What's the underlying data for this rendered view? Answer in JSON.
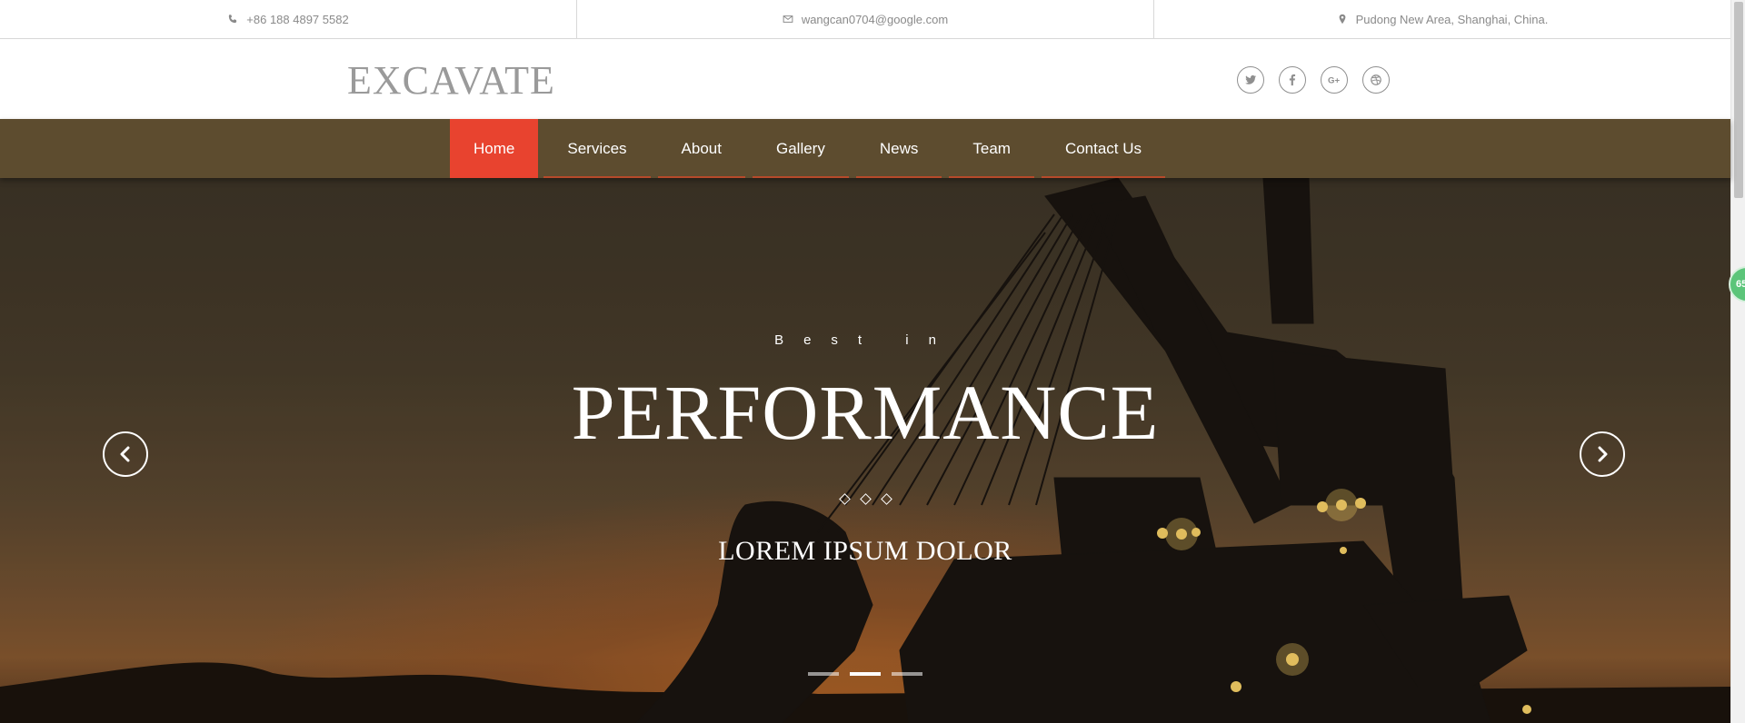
{
  "topbar": {
    "phone": "+86 188 4897 5582",
    "phone_icon": "phone-icon",
    "email": "wangcan0704@google.com",
    "email_icon": "envelope-icon",
    "address": "Pudong New Area, Shanghai, China.",
    "address_icon": "map-marker-icon"
  },
  "header": {
    "logo": "EXCAVATE",
    "social": [
      "twitter-icon",
      "facebook-icon",
      "google-plus-icon",
      "dribbble-icon"
    ]
  },
  "nav": {
    "items": [
      {
        "label": "Home",
        "active": true
      },
      {
        "label": "Services"
      },
      {
        "label": "About"
      },
      {
        "label": "Gallery"
      },
      {
        "label": "News"
      },
      {
        "label": "Team"
      },
      {
        "label": "Contact Us"
      }
    ],
    "accent_color": "#e8432f",
    "bar_color": "#5d4c2f"
  },
  "hero": {
    "pre_title": "Best in",
    "title": "PERFORMANCE",
    "subtitle": "LOREM IPSUM DOLOR",
    "prev_icon": "chevron-left-icon",
    "next_icon": "chevron-right-icon",
    "active_slide": 2,
    "slide_count": 3
  },
  "floating_badge": "65"
}
